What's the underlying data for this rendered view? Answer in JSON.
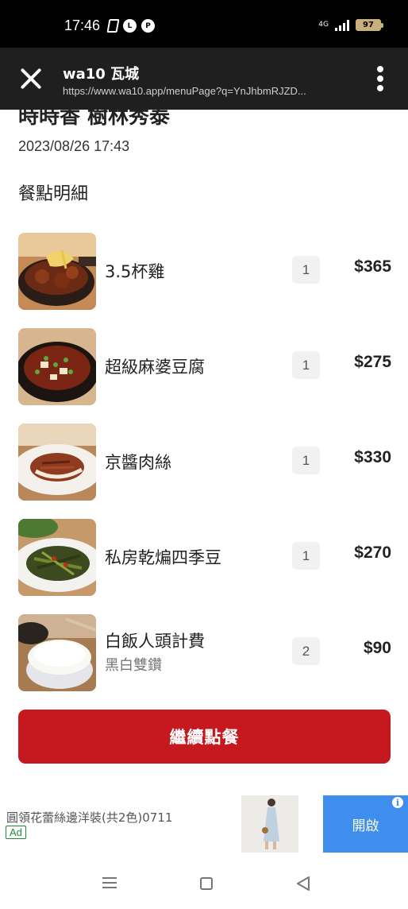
{
  "status_bar": {
    "time": "17:46",
    "network": "4G",
    "battery": "97",
    "app_icons": [
      "document-icon",
      "line-icon",
      "paypal-icon"
    ]
  },
  "browser": {
    "title": "wa10 瓦城",
    "url": "https://www.wa10.app/menuPage?q=YnJhbmRJZD..."
  },
  "order": {
    "shop_name": "時時香 樹林秀泰",
    "datetime": "2023/08/26 17:43",
    "section_title": "餐點明細",
    "items": [
      {
        "name": "3.5杯雞",
        "sub": "",
        "qty": "1",
        "price": "$365"
      },
      {
        "name": "超級麻婆豆腐",
        "sub": "",
        "qty": "1",
        "price": "$275"
      },
      {
        "name": "京醬肉絲",
        "sub": "",
        "qty": "1",
        "price": "$330"
      },
      {
        "name": "私房乾煸四季豆",
        "sub": "",
        "qty": "1",
        "price": "$270"
      },
      {
        "name": "白飯人頭計費",
        "sub": "黑白雙鑽",
        "qty": "2",
        "price": "$90"
      }
    ],
    "continue_label": "繼續點餐"
  },
  "ad": {
    "text": "圓領花蕾絲邊洋裝(共2色)0711",
    "badge": "Ad",
    "button": "開啟",
    "info": "i"
  },
  "colors": {
    "accent": "#c5181f",
    "ad_button": "#3f8ded",
    "browser_bar": "#1f1f1f"
  }
}
